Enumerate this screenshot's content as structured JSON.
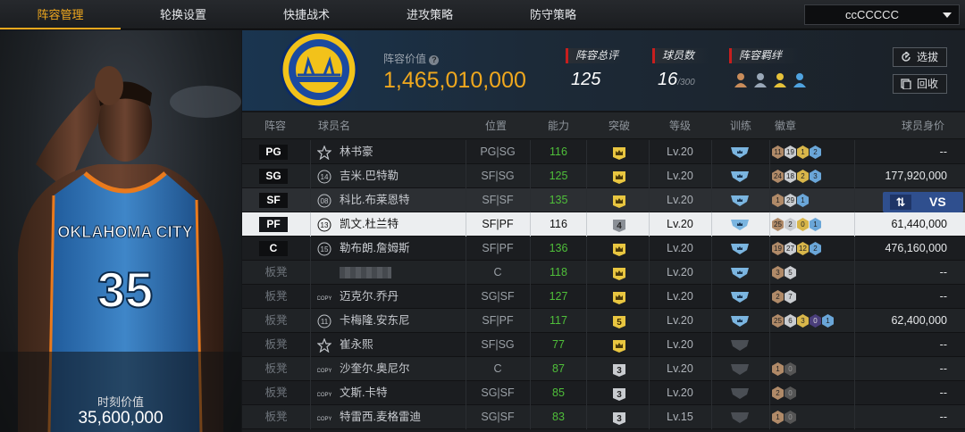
{
  "nav": {
    "tabs": [
      "阵容管理",
      "轮换设置",
      "快捷战术",
      "进攻策略",
      "防守策略"
    ],
    "active": 0,
    "team_select": "ccCCCCC"
  },
  "left_panel": {
    "jersey_team": "OKLAHOMA CITY",
    "jersey_number": "35",
    "moment_label": "时刻价值",
    "moment_value": "35,600,000"
  },
  "header": {
    "value_label": "阵容价值",
    "value": "1,465,010,000",
    "total_label": "阵容总评",
    "total": "125",
    "count_label": "球员数",
    "count": "16",
    "count_max": "/300",
    "bond_label": "阵容羁绊",
    "select_btn": "选拔",
    "recycle_btn": "回收"
  },
  "table": {
    "headers": [
      "阵容",
      "球员名",
      "位置",
      "能力",
      "突破",
      "等级",
      "训练",
      "徽章",
      "球员身价"
    ],
    "swap_vs": "VS",
    "rows": [
      {
        "slot": "PG",
        "bench": false,
        "icon": "star",
        "name": "林书豪",
        "pos": "PG|SG",
        "ability": "116",
        "brk": "crown",
        "lvl": "Lv.20",
        "train": true,
        "badges": [
          [
            "11",
            "bronze"
          ],
          [
            "19",
            "silver"
          ],
          [
            "1",
            "gold"
          ],
          [
            "2",
            "blue"
          ]
        ],
        "salary": "--"
      },
      {
        "slot": "SG",
        "bench": false,
        "icon": "14",
        "name": "吉米.巴特勒",
        "pos": "SF|SG",
        "ability": "125",
        "brk": "crown",
        "lvl": "Lv.20",
        "train": true,
        "badges": [
          [
            "24",
            "bronze"
          ],
          [
            "18",
            "silver"
          ],
          [
            "2",
            "gold"
          ],
          [
            "3",
            "blue"
          ]
        ],
        "salary": "177,920,000"
      },
      {
        "slot": "SF",
        "bench": false,
        "icon": "08",
        "name": "科比.布莱恩特",
        "pos": "SF|SF",
        "ability": "135",
        "brk": "crown",
        "lvl": "Lv.20",
        "train": true,
        "badges": [
          [
            "1",
            "bronze"
          ],
          [
            "29",
            "silver"
          ],
          [
            "1",
            "blue"
          ]
        ],
        "salary": "",
        "dim": true
      },
      {
        "slot": "PF",
        "bench": false,
        "icon": "13",
        "name": "凯文.杜兰特",
        "pos": "SF|PF",
        "ability": "116",
        "brk": "4",
        "lvl": "Lv.20",
        "train": true,
        "badges": [
          [
            "25",
            "bronze"
          ],
          [
            "2",
            "silver"
          ],
          [
            "0",
            "gold"
          ],
          [
            "1",
            "blue"
          ]
        ],
        "salary": "61,440,000",
        "sel": true
      },
      {
        "slot": "C",
        "bench": false,
        "icon": "15",
        "name": "勒布朗.詹姆斯",
        "pos": "SF|PF",
        "ability": "136",
        "brk": "crown",
        "lvl": "Lv.20",
        "train": true,
        "badges": [
          [
            "19",
            "bronze"
          ],
          [
            "27",
            "silver"
          ],
          [
            "12",
            "gold"
          ],
          [
            "2",
            "blue"
          ]
        ],
        "salary": "476,160,000"
      },
      {
        "slot": "板凳",
        "bench": true,
        "icon": "blank",
        "name": "",
        "pos": "C",
        "ability": "118",
        "brk": "crown",
        "lvl": "Lv.20",
        "train": true,
        "badges": [
          [
            "3",
            "bronze"
          ],
          [
            "5",
            "silver"
          ]
        ],
        "salary": "--"
      },
      {
        "slot": "板凳",
        "bench": true,
        "icon": "COPY",
        "name": "迈克尔.乔丹",
        "pos": "SG|SF",
        "ability": "127",
        "brk": "crown",
        "lvl": "Lv.20",
        "train": true,
        "badges": [
          [
            "2",
            "bronze"
          ],
          [
            "7",
            "silver"
          ]
        ],
        "salary": "--"
      },
      {
        "slot": "板凳",
        "bench": true,
        "icon": "11",
        "name": "卡梅隆.安东尼",
        "pos": "SF|PF",
        "ability": "117",
        "brk": "5",
        "lvl": "Lv.20",
        "train": true,
        "badges": [
          [
            "25",
            "bronze"
          ],
          [
            "6",
            "silver"
          ],
          [
            "3",
            "gold"
          ],
          [
            "0",
            "purple"
          ],
          [
            "1",
            "blue"
          ]
        ],
        "salary": "62,400,000"
      },
      {
        "slot": "板凳",
        "bench": true,
        "icon": "star",
        "name": "崔永熙",
        "pos": "SF|SG",
        "ability": "77",
        "brk": "crown",
        "lvl": "Lv.20",
        "train": false,
        "badges": [],
        "salary": "--"
      },
      {
        "slot": "板凳",
        "bench": true,
        "icon": "COPY",
        "name": "沙奎尔.奥尼尔",
        "pos": "C",
        "ability": "87",
        "brk": "3",
        "lvl": "Lv.20",
        "train": false,
        "badges": [
          [
            "1",
            "bronze"
          ],
          [
            "0",
            "dark"
          ]
        ],
        "salary": "--"
      },
      {
        "slot": "板凳",
        "bench": true,
        "icon": "COPY",
        "name": "文斯.卡特",
        "pos": "SG|SF",
        "ability": "85",
        "brk": "3",
        "lvl": "Lv.20",
        "train": false,
        "badges": [
          [
            "2",
            "bronze"
          ],
          [
            "0",
            "dark"
          ]
        ],
        "salary": "--"
      },
      {
        "slot": "板凳",
        "bench": true,
        "icon": "COPY",
        "name": "特雷西.麦格雷迪",
        "pos": "SG|SF",
        "ability": "83",
        "brk": "3",
        "lvl": "Lv.15",
        "train": false,
        "badges": [
          [
            "1",
            "bronze"
          ],
          [
            "0",
            "dark"
          ]
        ],
        "salary": "--"
      }
    ]
  }
}
